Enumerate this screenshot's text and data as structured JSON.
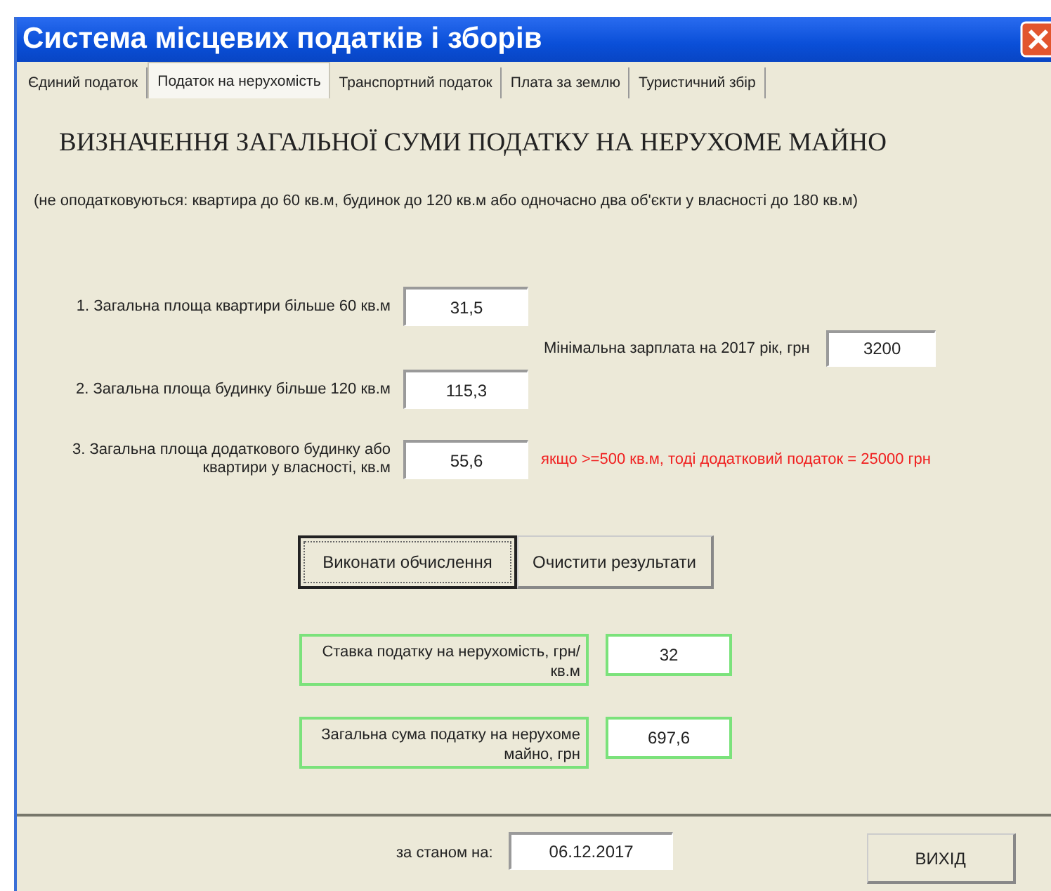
{
  "window": {
    "title": "Система місцевих податків і зборів"
  },
  "tabs": [
    {
      "label": "Єдиний податок",
      "selected": false
    },
    {
      "label": "Податок на нерухомість",
      "selected": true
    },
    {
      "label": "Транспортний податок",
      "selected": false
    },
    {
      "label": "Плата за землю",
      "selected": false
    },
    {
      "label": "Туристичний збір",
      "selected": false
    }
  ],
  "heading": "ВИЗНАЧЕННЯ ЗАГАЛЬНОЇ СУМИ ПОДАТКУ НА НЕРУХОМЕ МАЙНО",
  "note": "(не оподатковуються: квартира до 60 кв.м, будинок до 120 кв.м або одночасно два об'єкти у власності до 180 кв.м)",
  "inputs": [
    {
      "label": "1. Загальна площа квартири більше 60 кв.м",
      "value": "31,5"
    },
    {
      "label": "2. Загальна площа будинку більше 120 кв.м",
      "value": "115,3"
    },
    {
      "label": "3. Загальна площа додаткового будинку або квартири у власності, кв.м",
      "value": "55,6"
    }
  ],
  "min_wage": {
    "label": "Мінімальна зарплата на 2017 рік, грн",
    "value": "3200"
  },
  "warning": "якщо >=500 кв.м, тоді додатковий податок = 25000 грн",
  "buttons": [
    {
      "label": "Виконати обчислення",
      "focused": true
    },
    {
      "label": "Очистити результати",
      "focused": false
    }
  ],
  "results": [
    {
      "label": "Ставка податку на нерухомість, грн/кв.м",
      "value": "32"
    },
    {
      "label": "Загальна сума податку на нерухоме майно, грн",
      "value": "697,6"
    }
  ],
  "footer": {
    "date_label": "за станом на:",
    "date_value": "06.12.2017",
    "exit_label": "ВИХІД"
  }
}
